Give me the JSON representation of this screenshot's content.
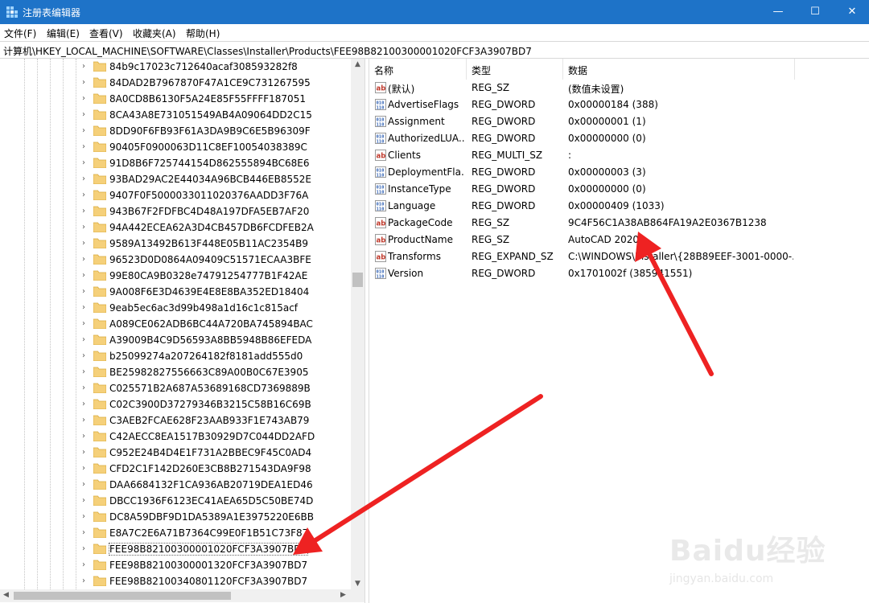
{
  "window": {
    "title": "注册表编辑器",
    "controls": {
      "minimize": "—",
      "maximize": "☐",
      "close": "✕"
    }
  },
  "menu": [
    "文件(F)",
    "编辑(E)",
    "查看(V)",
    "收藏夹(A)",
    "帮助(H)"
  ],
  "address": "计算机\\HKEY_LOCAL_MACHINE\\SOFTWARE\\Classes\\Installer\\Products\\FEE98B82100300001020FCF3A3907BD7",
  "tree": {
    "items": [
      "84b9c17023c712640acaf308593282f8",
      "84DAD2B7967870F47A1CE9C731267595",
      "8A0CD8B6130F5A24E85F55FFFF187051",
      "8CA43A8E731051549AB4A09064DD2C15",
      "8DD90F6FB93F61A3DA9B9C6E5B96309F",
      "90405F0900063D11C8EF10054038389C",
      "91D8B6F725744154D862555894BC68E6",
      "93BAD29AC2E44034A96BCB446EB8552E",
      "9407F0F5000033011020376AADD3F76A",
      "943B67F2FDFBC4D48A197DFA5EB7AF20",
      "94A442ECEA62A3D4CB457DB6FCDFEB2A",
      "9589A13492B613F448E05B11AC2354B9",
      "96523D0D0864A09409C51571ECAA3BFE",
      "99E80CA9B0328e74791254777B1F42AE",
      "9A008F6E3D4639E4E8E8BA352ED18404",
      "9eab5ec6ac3d99b498a1d16c1c815acf",
      "A089CE062ADB6BC44A720BA745894BAC",
      "A39009B4C9D56593A8BB5948B86EFEDA",
      "b25099274a207264182f8181add555d0",
      "BE25982827556663C89A00B0C67E3905",
      "C025571B2A687A53689168CD7369889B",
      "C02C3900D37279346B3215C58B16C69B",
      "C3AEB2FCAE628F23AAB933F1E743AB79",
      "C42AECC8EA1517B30929D7C044DD2AFD",
      "C952E24B4D4E1F731A2BBEC9F45C0AD4",
      "CFD2C1F142D260E3CB8B271543DA9F98",
      "DAA6684132F1CA936AB20719DEA1ED46",
      "DBCC1936F6123EC41AEA65D5C50BE74D",
      "DC8A59DBF9D1DA5389A1E3975220E6BB",
      "E8A7C2E6A71B7364C99E0F1B51C73F87",
      "FEE98B82100300001020FCF3A3907BD7",
      "FEE98B82100300001320FCF3A3907BD7",
      "FEE98B82100340801120FCF3A3907BD7"
    ]
  },
  "values": {
    "headers": {
      "name": "名称",
      "type": "类型",
      "data": "数据"
    },
    "rows": [
      {
        "icon": "string-value-icon",
        "name": "(默认)",
        "type": "REG_SZ",
        "data": "(数值未设置)"
      },
      {
        "icon": "binary-value-icon",
        "name": "AdvertiseFlags",
        "type": "REG_DWORD",
        "data": "0x00000184 (388)"
      },
      {
        "icon": "binary-value-icon",
        "name": "Assignment",
        "type": "REG_DWORD",
        "data": "0x00000001 (1)"
      },
      {
        "icon": "binary-value-icon",
        "name": "AuthorizedLUA...",
        "type": "REG_DWORD",
        "data": "0x00000000 (0)"
      },
      {
        "icon": "string-value-icon",
        "name": "Clients",
        "type": "REG_MULTI_SZ",
        "data": ":"
      },
      {
        "icon": "binary-value-icon",
        "name": "DeploymentFla...",
        "type": "REG_DWORD",
        "data": "0x00000003 (3)"
      },
      {
        "icon": "binary-value-icon",
        "name": "InstanceType",
        "type": "REG_DWORD",
        "data": "0x00000000 (0)"
      },
      {
        "icon": "binary-value-icon",
        "name": "Language",
        "type": "REG_DWORD",
        "data": "0x00000409 (1033)"
      },
      {
        "icon": "string-value-icon",
        "name": "PackageCode",
        "type": "REG_SZ",
        "data": "9C4F56C1A38AB864FA19A2E0367B1238"
      },
      {
        "icon": "string-value-icon",
        "name": "ProductName",
        "type": "REG_SZ",
        "data": "AutoCAD 2020"
      },
      {
        "icon": "string-value-icon",
        "name": "Transforms",
        "type": "REG_EXPAND_SZ",
        "data": "C:\\WINDOWS\\Installer\\{28B89EEF-3001-0000-..."
      },
      {
        "icon": "binary-value-icon",
        "name": "Version",
        "type": "REG_DWORD",
        "data": "0x1701002f (385941551)"
      }
    ]
  },
  "watermark": {
    "brand": "Baidu经验",
    "url": "jingyan.baidu.com"
  },
  "colors": {
    "titlebar": "#1e73c8",
    "arrow": "#ee2222",
    "folder": "#f5d07a"
  }
}
